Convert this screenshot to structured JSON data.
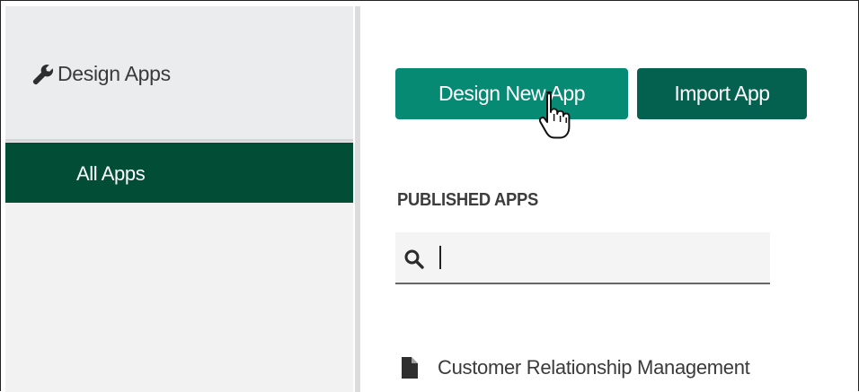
{
  "sidebar": {
    "title": "Design Apps",
    "title_icon": "wrench-icon",
    "items": [
      {
        "label": "All Apps",
        "selected": true
      }
    ]
  },
  "toolbar": {
    "design_new_label": "Design New App",
    "import_label": "Import App"
  },
  "published": {
    "section_label": "PUBLISHED APPS",
    "search": {
      "value": "",
      "icon": "search-icon"
    },
    "apps": [
      {
        "name": "Customer Relationship Management",
        "icon": "document-icon"
      }
    ]
  },
  "colors": {
    "primary_button": "#068a74",
    "secondary_button": "#046150",
    "selected_nav": "#024d36"
  }
}
